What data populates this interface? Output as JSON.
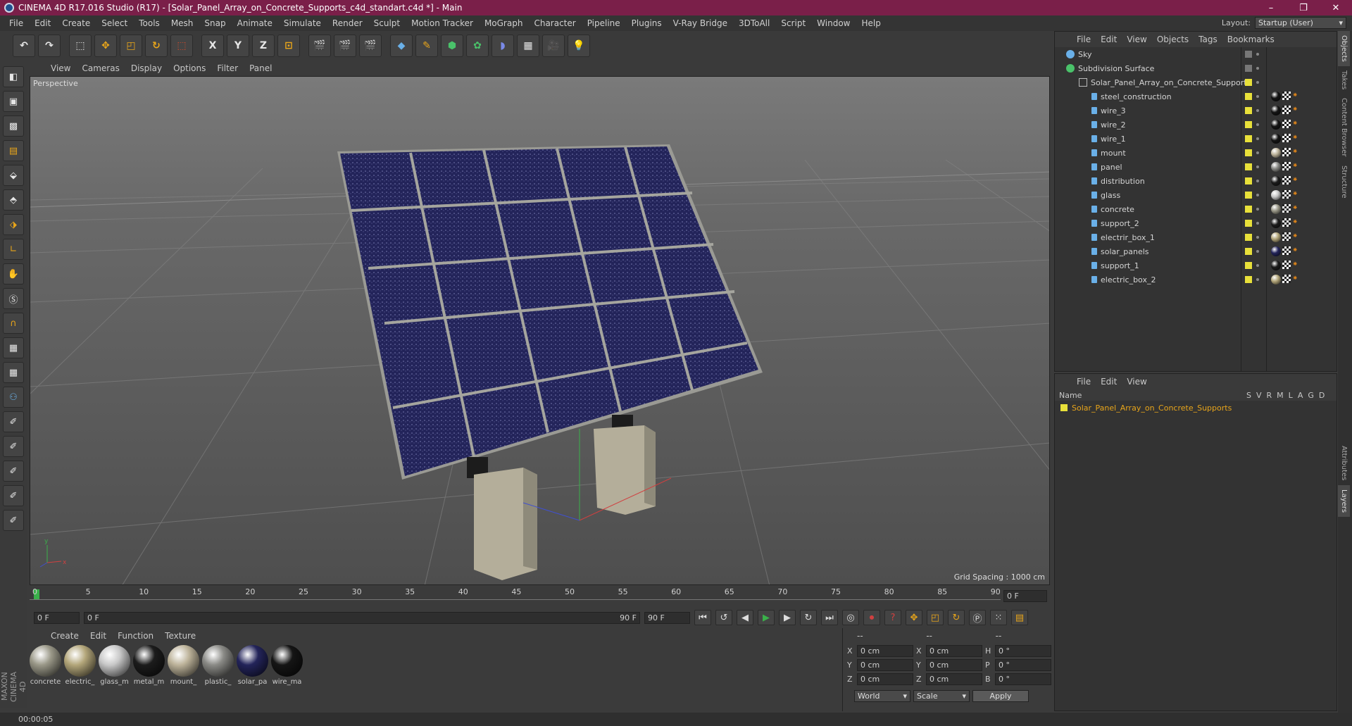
{
  "window": {
    "title": "CINEMA 4D R17.016 Studio (R17) - [Solar_Panel_Array_on_Concrete_Supports_c4d_standart.c4d *] - Main",
    "minimize": "–",
    "restore": "❐",
    "close": "✕"
  },
  "menu": [
    "File",
    "Edit",
    "Create",
    "Select",
    "Tools",
    "Mesh",
    "Snap",
    "Animate",
    "Simulate",
    "Render",
    "Sculpt",
    "Motion Tracker",
    "MoGraph",
    "Character",
    "Pipeline",
    "Plugins",
    "V-Ray Bridge",
    "3DToAll",
    "Script",
    "Window",
    "Help"
  ],
  "layout": {
    "label": "Layout:",
    "value": "Startup (User)"
  },
  "toolbar": {
    "x": "X",
    "y": "Y",
    "z": "Z"
  },
  "viewport": {
    "menu": [
      "View",
      "Cameras",
      "Display",
      "Options",
      "Filter",
      "Panel"
    ],
    "label": "Perspective",
    "grid_spacing": "Grid Spacing : 1000 cm"
  },
  "timeline": {
    "ticks": [
      "0",
      "5",
      "10",
      "15",
      "20",
      "25",
      "30",
      "35",
      "40",
      "45",
      "50",
      "55",
      "60",
      "65",
      "70",
      "75",
      "80",
      "85",
      "90"
    ],
    "frame_end": "0 F"
  },
  "playback": {
    "start": "0 F",
    "range_start": "0 F",
    "range_end": "90 F",
    "end": "90 F"
  },
  "materials": {
    "menu": [
      "Create",
      "Edit",
      "Function",
      "Texture"
    ],
    "items": [
      {
        "label": "concrete",
        "color": "#9a9888"
      },
      {
        "label": "electric_",
        "color": "#b3a67a"
      },
      {
        "label": "glass_m",
        "color": "#c8c8c8"
      },
      {
        "label": "metal_m",
        "color": "#1c1c1c"
      },
      {
        "label": "mount_",
        "color": "#bdb39a"
      },
      {
        "label": "plastic_",
        "color": "#8a8a86"
      },
      {
        "label": "solar_pa",
        "color": "#23245a"
      },
      {
        "label": "wire_ma",
        "color": "#151515"
      }
    ]
  },
  "coords": {
    "header": [
      "--",
      "--",
      "--"
    ],
    "rows": [
      {
        "a": "X",
        "av": "0 cm",
        "b": "X",
        "bv": "0 cm",
        "c": "H",
        "cv": "0 °"
      },
      {
        "a": "Y",
        "av": "0 cm",
        "b": "Y",
        "bv": "0 cm",
        "c": "P",
        "cv": "0 °"
      },
      {
        "a": "Z",
        "av": "0 cm",
        "b": "Z",
        "bv": "0 cm",
        "c": "B",
        "cv": "0 °"
      }
    ],
    "world": "World",
    "scale": "Scale",
    "apply": "Apply"
  },
  "status": "00:00:05",
  "objects": {
    "menu": [
      "File",
      "Edit",
      "View",
      "Objects",
      "Tags",
      "Bookmarks"
    ],
    "items": [
      {
        "name": "Sky",
        "icon": "sky-icon",
        "level": 0
      },
      {
        "name": "Subdivision Surface",
        "icon": "subdivision-icon",
        "level": 0
      },
      {
        "name": "Solar_Panel_Array_on_Concrete_Supports",
        "icon": "null-icon",
        "level": 1
      },
      {
        "name": "steel_construction",
        "mat": "#151515",
        "level": 2
      },
      {
        "name": "wire_3",
        "mat": "#151515",
        "level": 2
      },
      {
        "name": "wire_2",
        "mat": "#151515",
        "level": 2
      },
      {
        "name": "wire_1",
        "mat": "#151515",
        "level": 2
      },
      {
        "name": "mount",
        "mat": "#bdb39a",
        "level": 2
      },
      {
        "name": "panel",
        "mat": "#8a8a86",
        "level": 2
      },
      {
        "name": "distribution",
        "mat": "#1c1c1c",
        "level": 2
      },
      {
        "name": "glass",
        "mat": "#c8c8c8",
        "level": 2
      },
      {
        "name": "concrete",
        "mat": "#9a9888",
        "level": 2
      },
      {
        "name": "support_2",
        "mat": "#1c1c1c",
        "level": 2
      },
      {
        "name": "electrir_box_1",
        "mat": "#b3a67a",
        "level": 2
      },
      {
        "name": "solar_panels",
        "mat": "#23245a",
        "level": 2
      },
      {
        "name": "support_1",
        "mat": "#1c1c1c",
        "level": 2
      },
      {
        "name": "electric_box_2",
        "mat": "#b3a67a",
        "level": 2
      }
    ]
  },
  "layers": {
    "menu": [
      "File",
      "Edit",
      "View"
    ],
    "header": {
      "name": "Name",
      "cols": [
        "S",
        "V",
        "R",
        "M",
        "L",
        "A",
        "G",
        "D"
      ]
    },
    "item": "Solar_Panel_Array_on_Concrete_Supports"
  },
  "side_tabs": [
    "Objects",
    "Takes",
    "Content Browser",
    "Structure",
    "Attributes",
    "Layers"
  ]
}
